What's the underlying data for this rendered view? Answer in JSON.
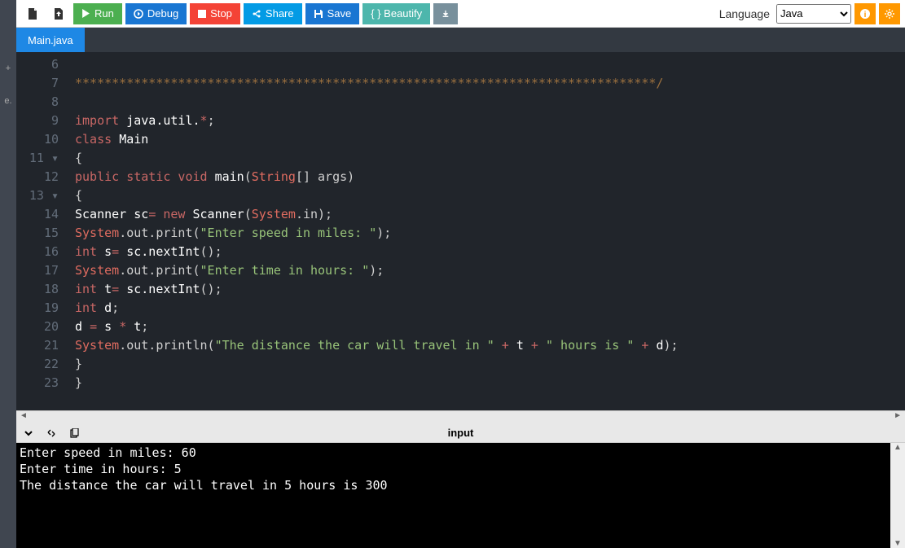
{
  "toolbar": {
    "run": "Run",
    "debug": "Debug",
    "stop": "Stop",
    "share": "Share",
    "save": "Save",
    "beautify": "{ } Beautify",
    "language_label": "Language",
    "language_value": "Java"
  },
  "tabs": {
    "active": "Main.java"
  },
  "gutter": [
    "6",
    "7",
    "8",
    "9",
    "10",
    "11",
    "12",
    "13",
    "14",
    "15",
    "16",
    "17",
    "18",
    "19",
    "20",
    "21",
    "22",
    "23"
  ],
  "folds": {
    "11": "▾",
    "13": "▾"
  },
  "code_html": "<span class='c-punct'>\n</span><span class='c-star'>*******************************************************************************/</span>\n\n<span class='c-kw'>import</span> <span class='c-id'>java.util.</span><span class='c-op'>*</span><span class='c-punct'>;</span>\n<span class='c-kw'>class</span> <span class='c-id'>Main</span>\n<span class='c-punct'>{</span>\n<span class='c-kw'>public static void</span> <span class='c-fn'>main</span><span class='c-punct'>(</span><span class='c-sys'>String</span><span class='c-punct'>[] args)</span>\n<span class='c-punct'>{</span>\n<span class='c-id'>Scanner sc</span><span class='c-op'>=</span> <span class='c-kw'>new</span> <span class='c-id'>Scanner</span><span class='c-punct'>(</span><span class='c-sys'>System</span><span class='c-punct'>.in);</span>\n<span class='c-sys'>System</span><span class='c-punct'>.out.print(</span><span class='c-str'>\"Enter speed in miles: \"</span><span class='c-punct'>);</span>\n<span class='c-kw'>int</span> <span class='c-id'>s</span><span class='c-op'>=</span> <span class='c-id'>sc.nextInt</span><span class='c-punct'>();</span>\n<span class='c-sys'>System</span><span class='c-punct'>.out.print(</span><span class='c-str'>\"Enter time in hours: \"</span><span class='c-punct'>);</span>\n<span class='c-kw'>int</span> <span class='c-id'>t</span><span class='c-op'>=</span> <span class='c-id'>sc.nextInt</span><span class='c-punct'>();</span>\n<span class='c-kw'>int</span> <span class='c-id'>d</span><span class='c-punct'>;</span>\n<span class='c-id'>d</span> <span class='c-op'>=</span> <span class='c-id'>s</span> <span class='c-op'>*</span> <span class='c-id'>t</span><span class='c-punct'>;</span>\n<span class='c-sys'>System</span><span class='c-punct'>.out.println(</span><span class='c-str'>\"The distance the car will travel in \"</span> <span class='c-op'>+</span> <span class='c-id'>t</span> <span class='c-op'>+</span> <span class='c-str'>\" hours is \"</span> <span class='c-op'>+</span> <span class='c-id'>d</span><span class='c-punct'>);</span>\n<span class='c-punct'>}</span>\n<span class='c-punct'>}</span>",
  "console": {
    "title": "input",
    "output": "Enter speed in miles: 60\nEnter time in hours: 5\nThe distance the car will travel in 5 hours is 300"
  },
  "sidebar": {
    "a": "+",
    "b": "e.",
    "c": "<"
  }
}
